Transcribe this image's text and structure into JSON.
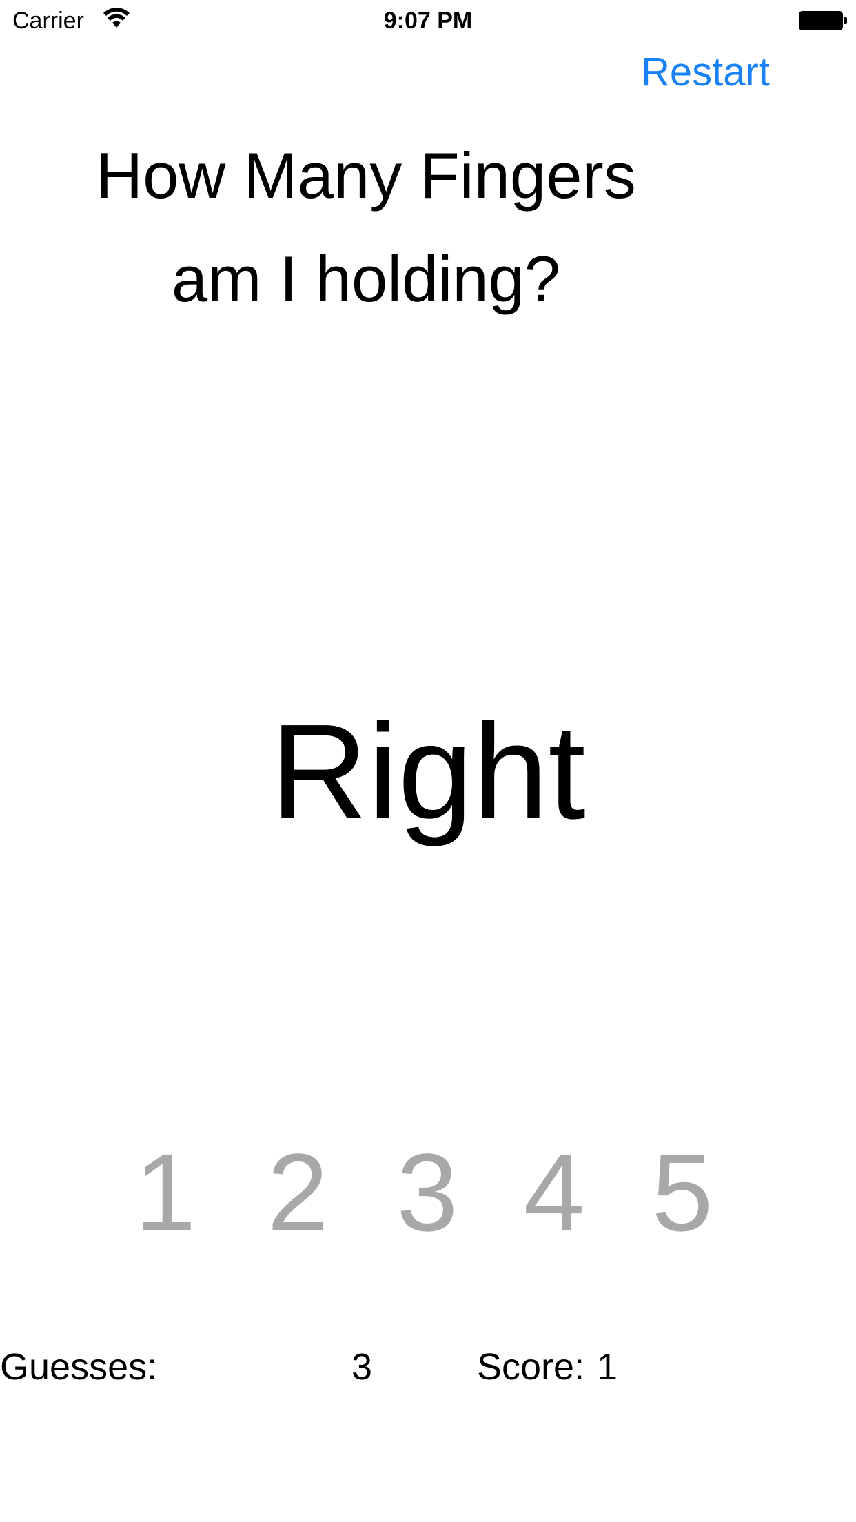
{
  "status_bar": {
    "carrier": "Carrier",
    "time": "9:07 PM",
    "icons": [
      "wifi-icon",
      "battery-icon"
    ]
  },
  "header": {
    "restart_label": "Restart"
  },
  "question": {
    "line1": "How Many Fingers",
    "line2": "am I holding?"
  },
  "result": {
    "text": "Right"
  },
  "finger_buttons": [
    "1",
    "2",
    "3",
    "4",
    "5"
  ],
  "stats": {
    "guesses_label": "Guesses:",
    "guesses_value": "3",
    "score_label": "Score:",
    "score_value": "1"
  },
  "colors": {
    "accent": "#1a82f7",
    "disabled_digit": "#a8a8a8",
    "text": "#000000",
    "background": "#ffffff"
  }
}
